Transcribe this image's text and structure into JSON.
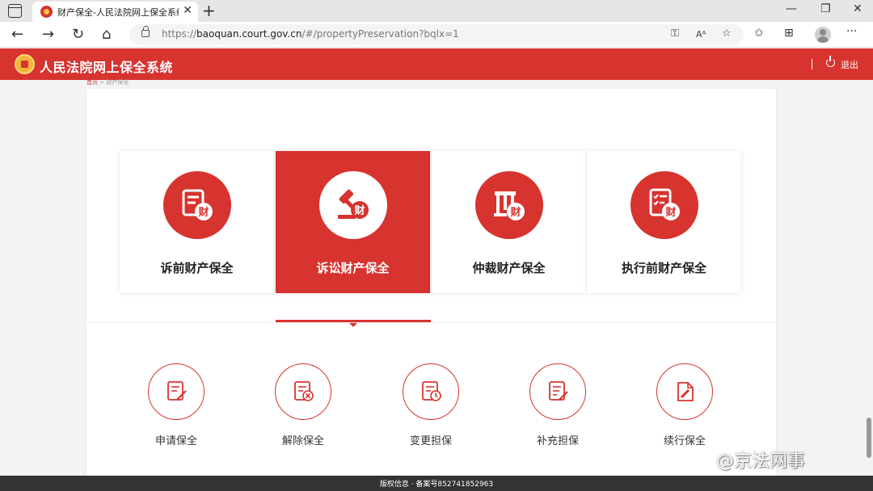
{
  "browser": {
    "tab_title": "财产保全-人民法院网上保全系统",
    "tab_close": "✕",
    "new_tab": "+",
    "url_scheme": "https://",
    "url_host": "baoquan.court.gov.cn",
    "url_path": "/#/propertyPreservation?bqlx=1",
    "window_controls": {
      "minimize": "—",
      "restore": "❐",
      "close": "✕"
    },
    "nav": {
      "back": "←",
      "forward": "→",
      "refresh": "↻",
      "home": "⌂"
    },
    "tools": {
      "key": "⚿",
      "read": "Aᴬ",
      "favorite_add": "☆",
      "favorites": "✩",
      "collections": "⊞",
      "more": "···"
    }
  },
  "header": {
    "title": "人民法院网上保全系统",
    "divider": "|",
    "logout_label": "退出",
    "brand_color": "#d7332f"
  },
  "breadcrumb": {
    "home": "首页",
    "separator": ">",
    "current": "财产保全"
  },
  "categories": [
    {
      "label": "诉前财产保全",
      "icon": "document-property-icon",
      "active": false
    },
    {
      "label": "诉讼财产保全",
      "icon": "gavel-property-icon",
      "active": true
    },
    {
      "label": "仲裁财产保全",
      "icon": "arbitration-property-icon",
      "active": false
    },
    {
      "label": "执行前财产保全",
      "icon": "checklist-property-icon",
      "active": false
    }
  ],
  "actions": [
    {
      "label": "申请保全",
      "icon": "apply-edit-icon"
    },
    {
      "label": "解除保全",
      "icon": "release-icon"
    },
    {
      "label": "变更担保",
      "icon": "change-guarantee-icon"
    },
    {
      "label": "补充担保",
      "icon": "supplement-guarantee-icon"
    },
    {
      "label": "续行保全",
      "icon": "renew-icon"
    }
  ],
  "footer": {
    "text": "版权信息 · 备案号852741852963"
  },
  "watermark": "@京法网事",
  "property_glyph": "财"
}
